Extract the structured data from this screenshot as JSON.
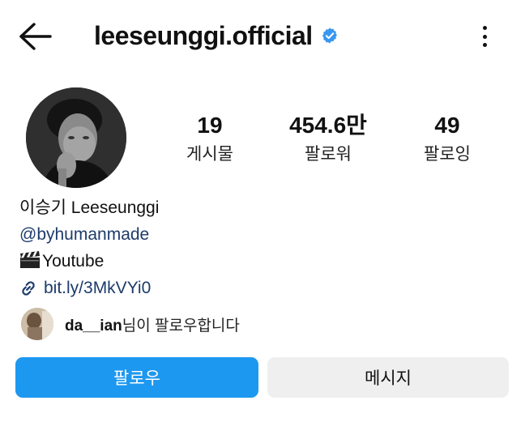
{
  "header": {
    "username": "leeseunggi.official",
    "back_icon": "arrow-left-icon",
    "verified_icon": "verified-badge-icon",
    "more_icon": "more-vertical-icon"
  },
  "stats": [
    {
      "value": "19",
      "label": "게시물"
    },
    {
      "value": "454.6만",
      "label": "팔로워"
    },
    {
      "value": "49",
      "label": "팔로잉"
    }
  ],
  "bio": {
    "name": "이승기 Leeseunggi",
    "mention": "@byhumanmade",
    "line3_emoji": "clapper-board-icon",
    "line3_text": "Youtube",
    "link": "bit.ly/3MkVYi0"
  },
  "followed_by": {
    "username": "da__ian",
    "suffix": "님이 팔로우합니다"
  },
  "actions": {
    "follow_label": "팔로우",
    "message_label": "메시지"
  },
  "colors": {
    "accent": "#1d98f0",
    "link": "#1d3b6b",
    "verified": "#3897f0",
    "secondary_button": "#efefef"
  }
}
